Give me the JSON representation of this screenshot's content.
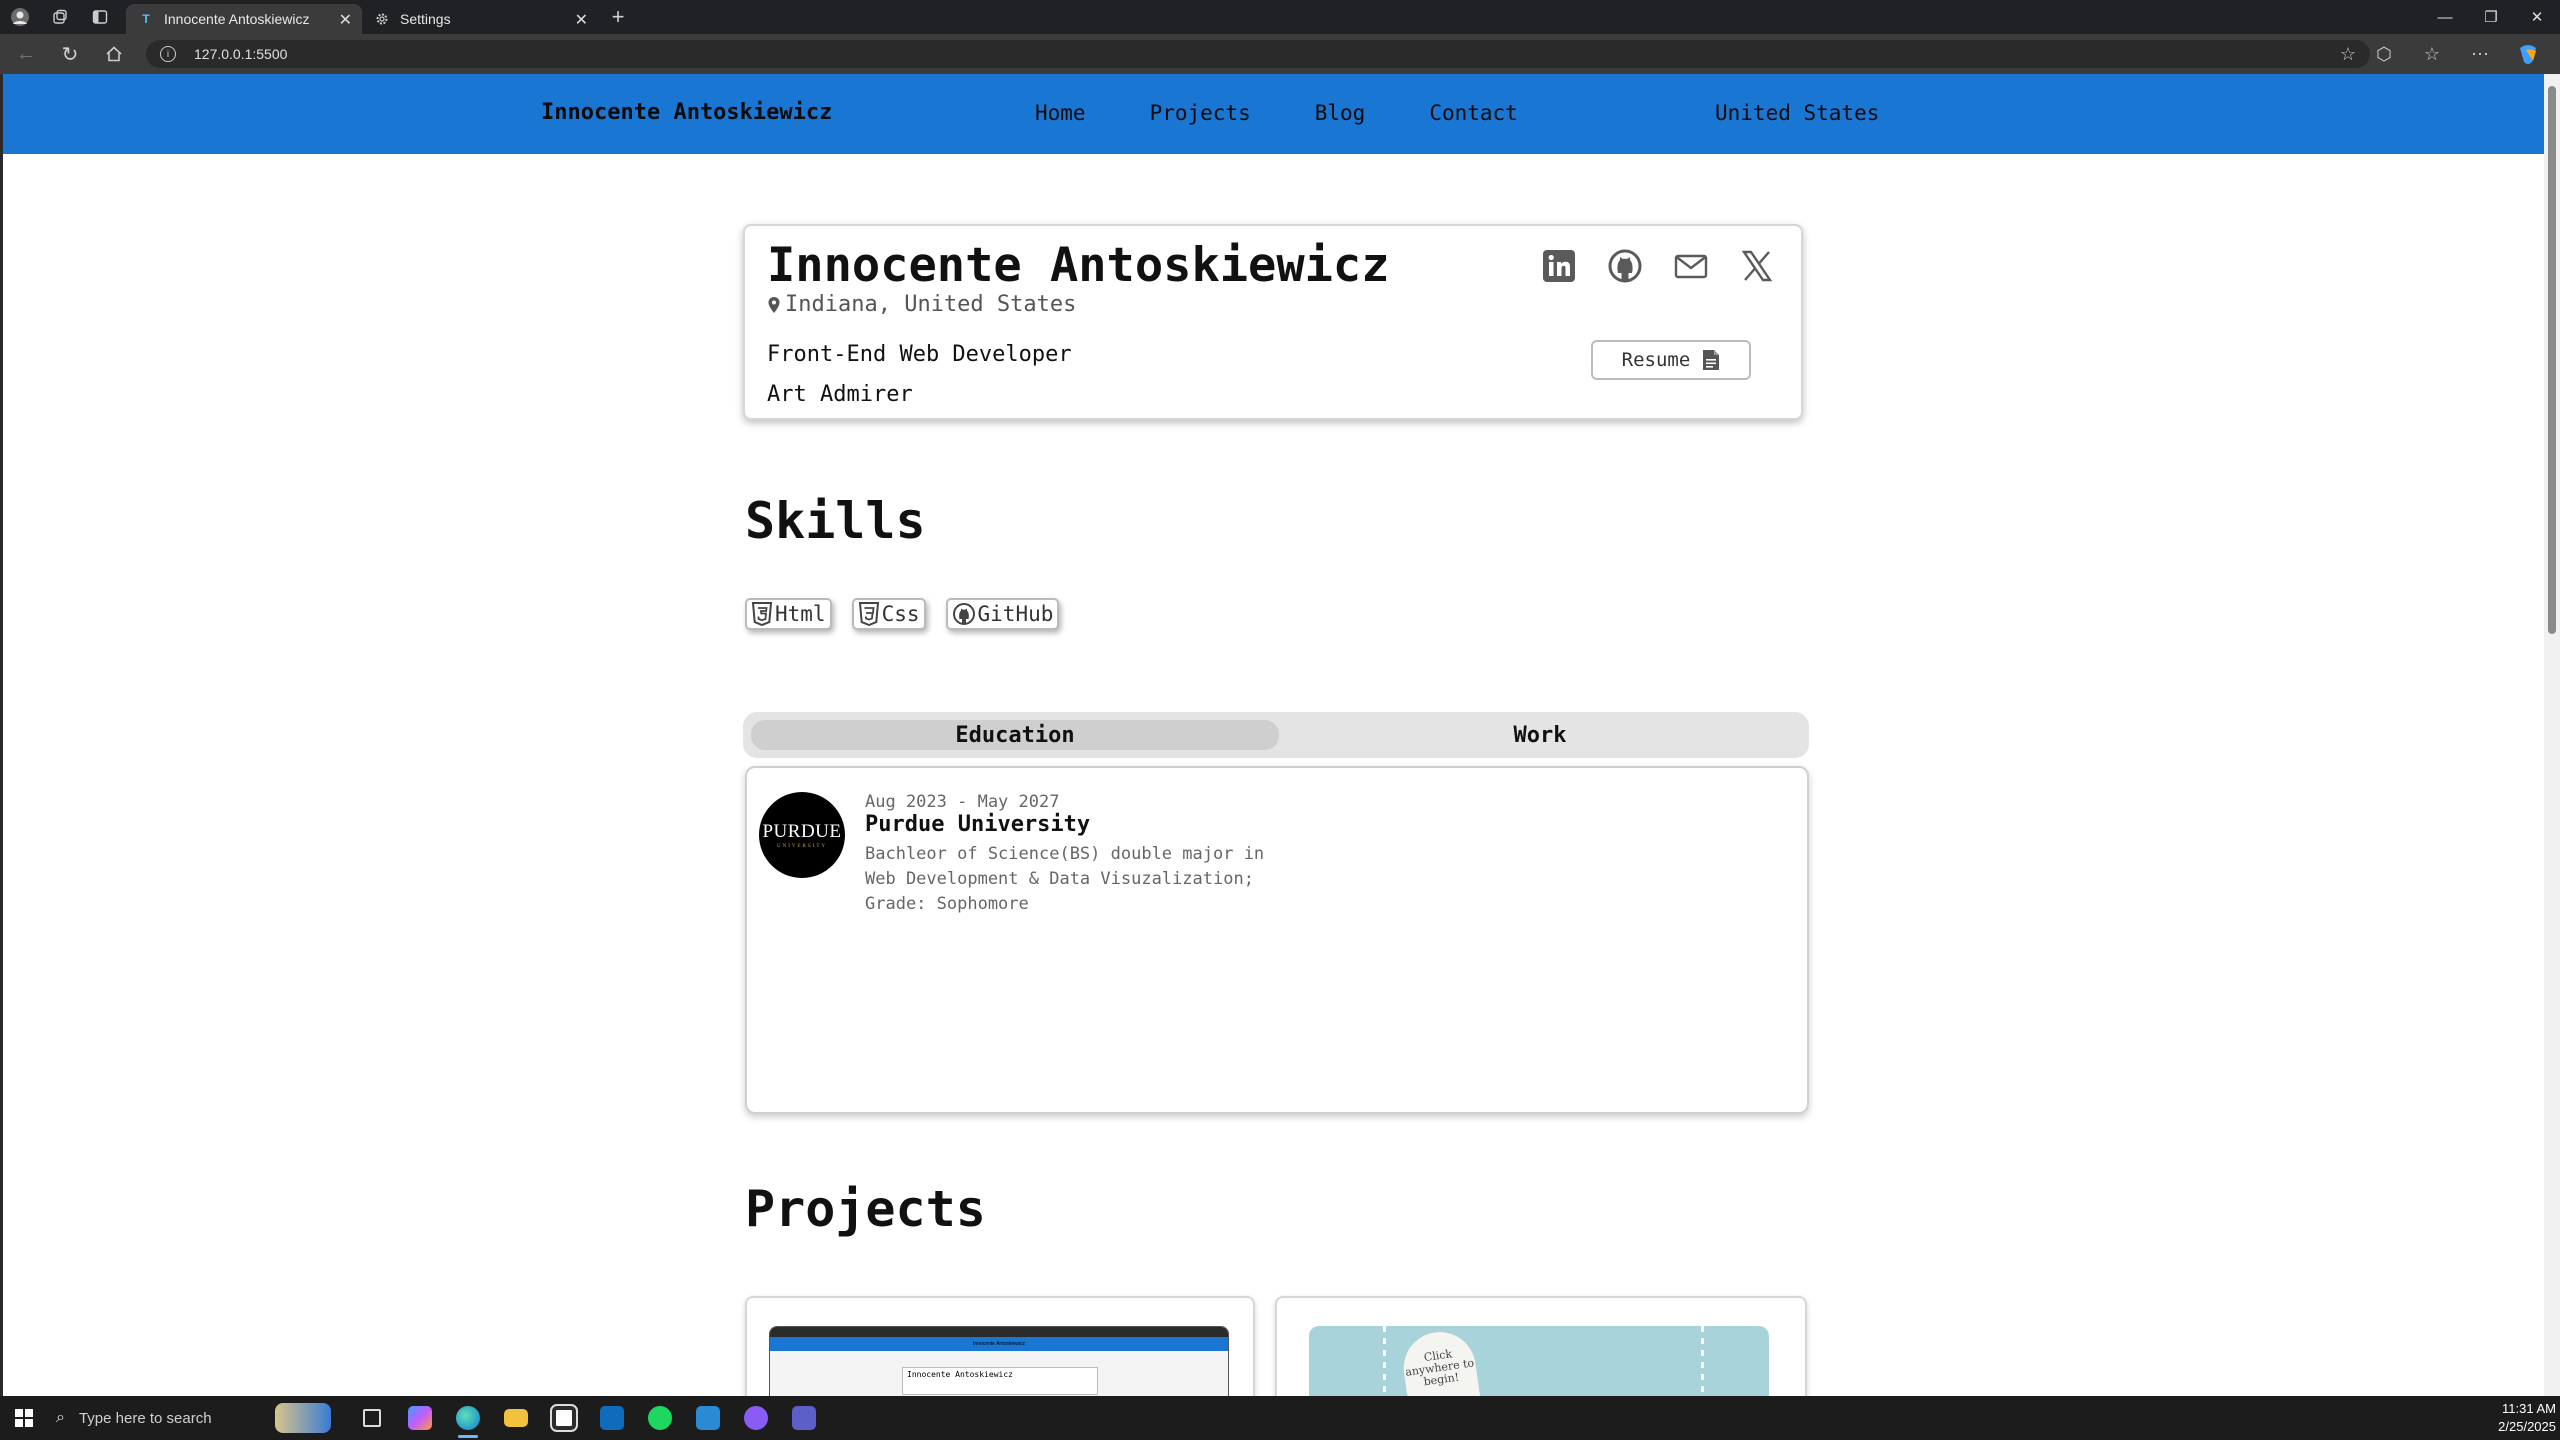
{
  "browser": {
    "tabs": [
      {
        "title": "Innocente Antoskiewicz",
        "favicon": "T",
        "active": true
      },
      {
        "title": "Settings",
        "favicon": "gear-icon",
        "active": false
      }
    ],
    "url": "127.0.0.1:5500",
    "new_tab": "+"
  },
  "site": {
    "brand": "Innocente Antoskiewicz",
    "nav": [
      "Home",
      "Projects",
      "Blog",
      "Contact"
    ],
    "country": "United States"
  },
  "profile": {
    "name": "Innocente Antoskiewicz",
    "location": "Indiana, United States",
    "roles": [
      "Front-End Web Developer",
      "Art Admirer"
    ],
    "resume_label": "Resume",
    "socials": [
      "linkedin-icon",
      "github-icon",
      "mail-icon",
      "x-icon"
    ]
  },
  "skills": {
    "title": "Skills",
    "items": [
      "Html",
      "Css",
      "GitHub"
    ]
  },
  "experience": {
    "tabs": [
      "Education",
      "Work"
    ],
    "selected": "Education",
    "entry": {
      "logo_text": "PURDUE",
      "logo_subtext": "UNIVERSITY",
      "dates": "Aug 2023 - May 2027",
      "school": "Purdue University",
      "description": "Bachleor of Science(BS) double major in Web Development & Data Visuzalization; Grade: Sophomore"
    }
  },
  "projects": {
    "title": "Projects",
    "thumb1_brand": "Innocente Antoskiewicz",
    "thumb2_text": "Click anywhere to begin!"
  },
  "taskbar": {
    "search_placeholder": "Type here to search",
    "time": "11:31 AM",
    "date": "2/25/2025"
  },
  "colors": {
    "site_nav": "#1976d2",
    "chrome_dark": "#202124",
    "taskbar": "#1c1c1c"
  }
}
